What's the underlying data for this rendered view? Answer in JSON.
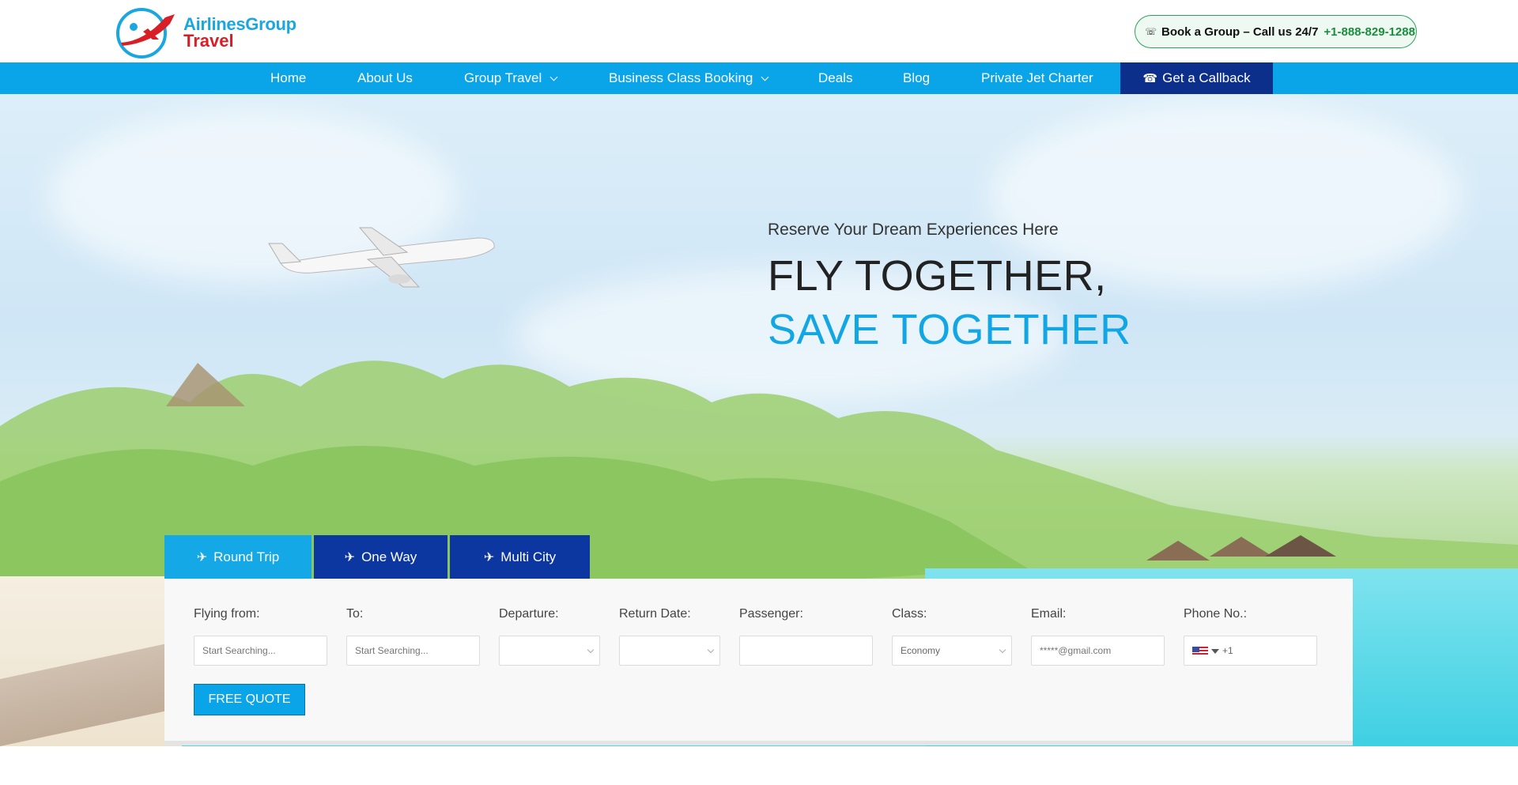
{
  "header": {
    "logo": {
      "line1": "AirlinesGroup",
      "line2": "Travel"
    },
    "call_pill": {
      "icon": "phone-icon",
      "text": "Book a Group – Call us 24/7",
      "number": "+1-888-829-1288"
    }
  },
  "nav": {
    "items": [
      {
        "label": "Home",
        "has_dropdown": false
      },
      {
        "label": "About Us",
        "has_dropdown": false
      },
      {
        "label": "Group Travel",
        "has_dropdown": true
      },
      {
        "label": "Business Class Booking",
        "has_dropdown": true
      },
      {
        "label": "Deals",
        "has_dropdown": false
      },
      {
        "label": "Blog",
        "has_dropdown": false
      },
      {
        "label": "Private Jet Charter",
        "has_dropdown": false
      }
    ],
    "callback": {
      "label": "Get a Callback",
      "icon": "phone-call-icon"
    }
  },
  "hero": {
    "subtitle": "Reserve Your Dream Experiences Here",
    "title_plain": "FLY TOGETHER, ",
    "title_accent": "SAVE TOGETHER"
  },
  "booking": {
    "tabs": [
      {
        "label": "Round Trip",
        "active": true,
        "icon": "plane-icon"
      },
      {
        "label": "One Way",
        "active": false,
        "icon": "plane-icon"
      },
      {
        "label": "Multi City",
        "active": false,
        "icon": "plane-icon"
      }
    ],
    "fields": {
      "from": {
        "label": "Flying from:",
        "placeholder": "Start Searching..."
      },
      "to": {
        "label": "To:",
        "placeholder": "Start Searching..."
      },
      "departure": {
        "label": "Departure:",
        "value": ""
      },
      "return": {
        "label": "Return Date:",
        "value": ""
      },
      "passenger": {
        "label": "Passenger:",
        "value": ""
      },
      "class": {
        "label": "Class:",
        "value": "Economy"
      },
      "email": {
        "label": "Email:",
        "placeholder": "*****@gmail.com"
      },
      "phone": {
        "label": "Phone No.:",
        "placeholder": "+1"
      }
    },
    "submit_label": "FREE QUOTE"
  },
  "colors": {
    "nav_bg": "#0aa4e8",
    "callback_bg": "#0c2f8c",
    "accent": "#12a7e4",
    "tab_inactive": "#0c37a1",
    "phone_green": "#1a8d3e"
  }
}
